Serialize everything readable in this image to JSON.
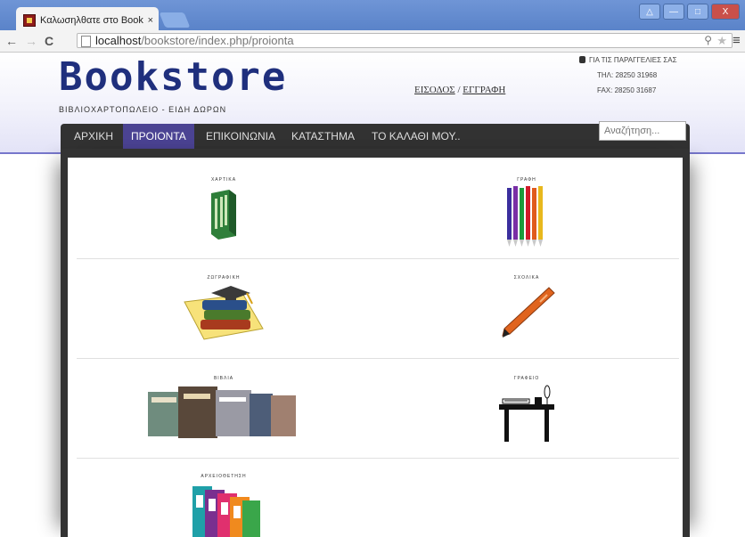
{
  "browser": {
    "tab_title": "Καλωσηλθατε στο Booksi",
    "tab_close": "×",
    "url_host": "localhost",
    "url_path": "/bookstore/index.php/proionta",
    "window_buttons": [
      "△",
      "—",
      "□",
      "X"
    ]
  },
  "site": {
    "logo": "Bookstore",
    "tagline": "ΒΙΒΛΙΟΧΑΡΤΟΠΩΛΕΙΟ - ΕΙΔΗ ΔΩΡΩΝ",
    "login": "ΕΙΣΟΔΟΣ",
    "separator": "/",
    "register": "ΕΓΓΡΑΦΗ",
    "contact_title": "ΓΙΑ ΤΙΣ ΠΑΡΑΓΓΕΛΙΕΣ ΣΑΣ",
    "phone": "ΤΗΛ: 28250 31968",
    "fax": "FAX: 28250 31687"
  },
  "nav": {
    "items": [
      "ΑΡΧΙΚΗ",
      "ΠΡΟΙΟΝΤΑ",
      "ΕΠΙΚΟΙΝΩΝΙΑ",
      "ΚΑΤΑΣΤΗΜΑ",
      "ΤΟ ΚΑΛΑΘΙ ΜΟΥ.."
    ],
    "active": "ΠΡΟΙΟΝΤΑ"
  },
  "search": {
    "placeholder": "Αναζήτηση..."
  },
  "categories": [
    {
      "label": "ΧΑΡΤΙΚΑ",
      "icon": "paper-ream-icon"
    },
    {
      "label": "ΓΡΑΦΗ",
      "icon": "pens-icon"
    },
    {
      "label": "ΖΩΓΡΑΦΙΚΗ",
      "icon": "books-graduation-icon"
    },
    {
      "label": "ΣΧΟΛΙΚΑ",
      "icon": "pen-icon"
    },
    {
      "label": "ΒΙΒΛΙΑ",
      "icon": "book-covers-icon"
    },
    {
      "label": "ΓΡΑΦΕΙΟ",
      "icon": "desk-icon"
    },
    {
      "label": "ΑΡΧΕΙΟΘΕΤΗΣΗ",
      "icon": "folders-icon"
    }
  ],
  "colors": {
    "nav_active": "#4b4393",
    "logo": "#1f2f7d",
    "nav_bg": "#323232"
  }
}
